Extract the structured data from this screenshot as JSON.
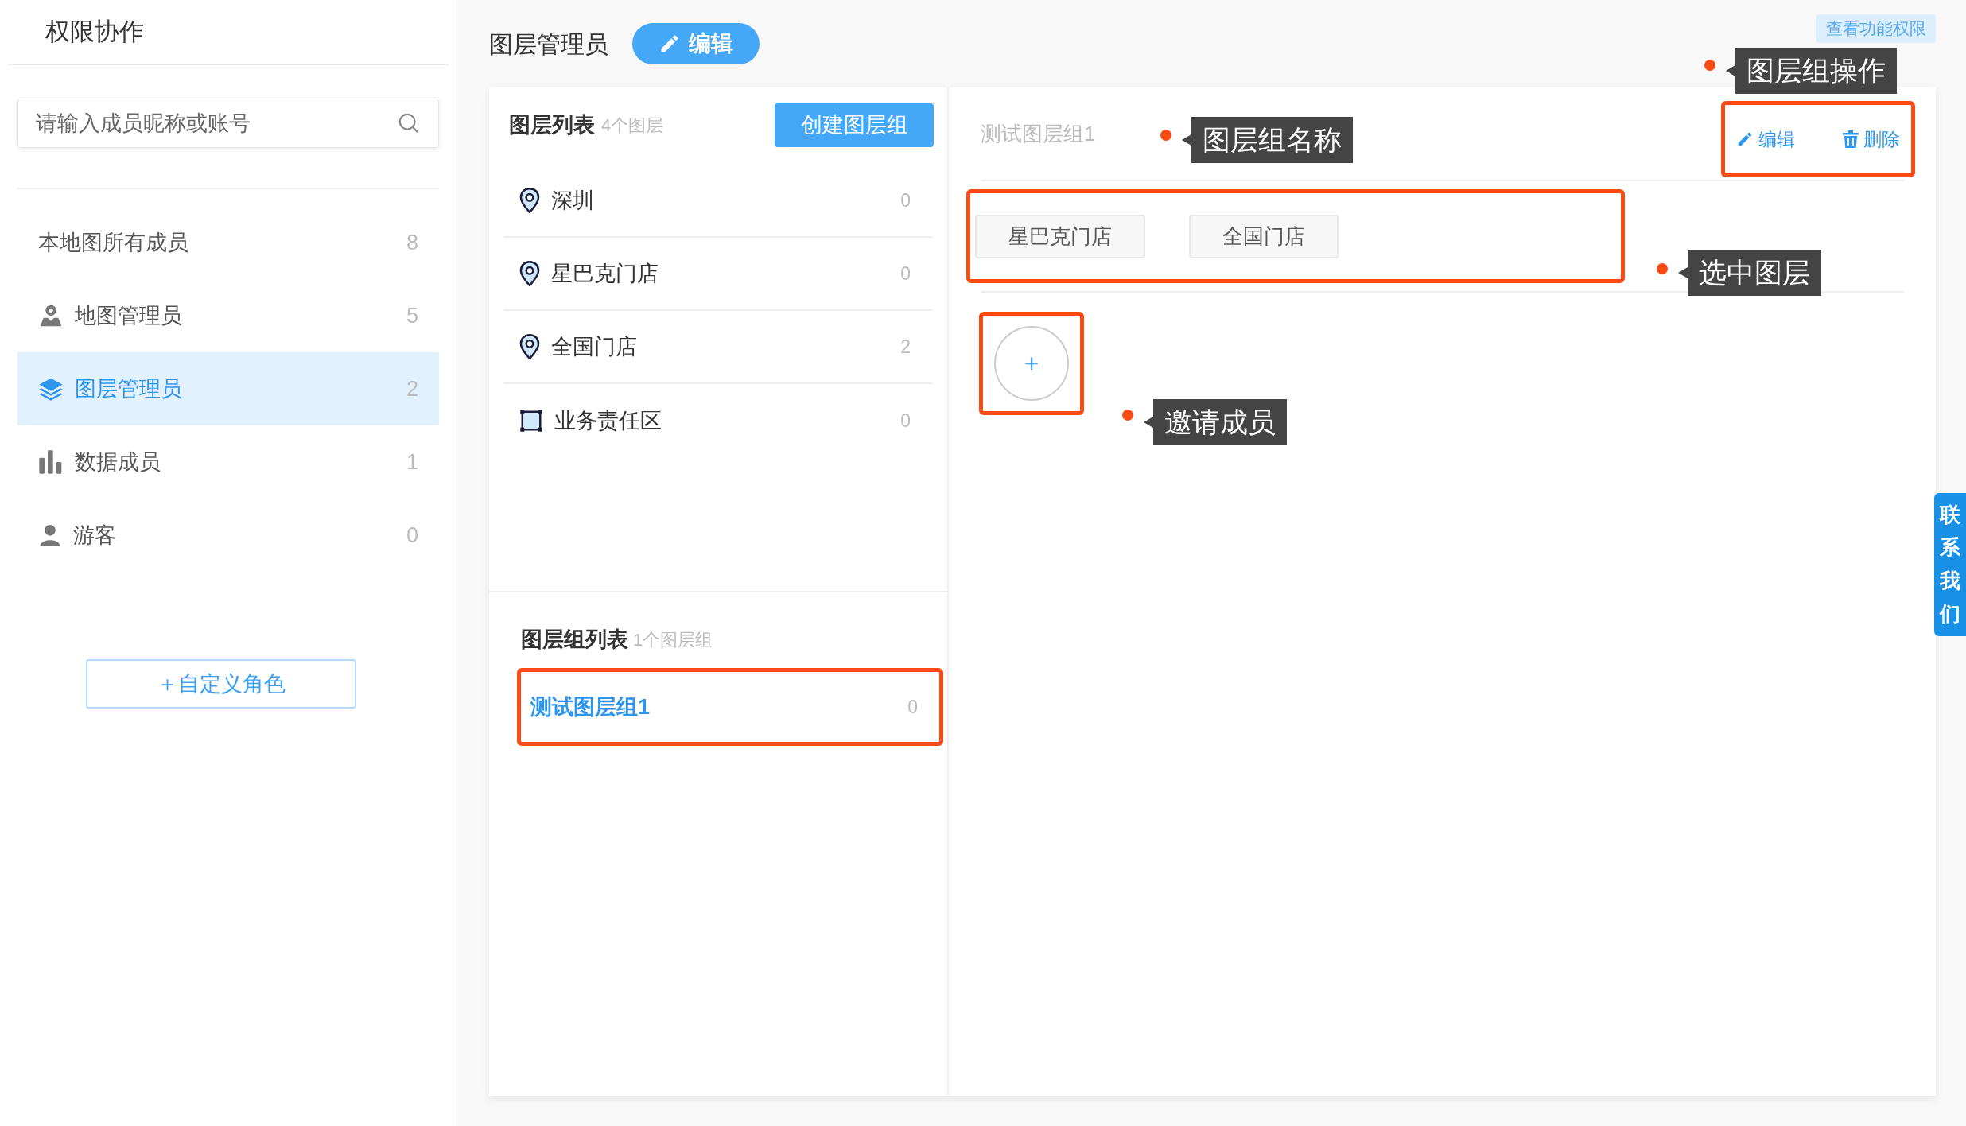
{
  "sidebar": {
    "title": "权限协作",
    "search": {
      "placeholder": "请输入成员昵称或账号"
    },
    "items": [
      {
        "label": "本地图所有成员",
        "count": "8",
        "selected": false
      },
      {
        "label": "地图管理员",
        "count": "5",
        "selected": false
      },
      {
        "label": "图层管理员",
        "count": "2",
        "selected": true
      },
      {
        "label": "数据成员",
        "count": "1",
        "selected": false
      },
      {
        "label": "游客",
        "count": "0",
        "selected": false
      }
    ],
    "add_button": "＋自定义角色"
  },
  "header": {
    "title": "图层管理员",
    "edit_button": "编辑",
    "permissions_button": "查看功能权限"
  },
  "layer_list": {
    "title": "图层列表",
    "subtitle": "4个图层",
    "create_button": "创建图层组",
    "items": [
      {
        "kind": "point",
        "label": "深圳",
        "count": "0"
      },
      {
        "kind": "point",
        "label": "星巴克门店",
        "count": "0"
      },
      {
        "kind": "point",
        "label": "全国门店",
        "count": "2"
      },
      {
        "kind": "polygon",
        "label": "业务责任区",
        "count": "0"
      }
    ]
  },
  "group_list": {
    "title": "图层组列表",
    "subtitle": "1个图层组",
    "items": [
      {
        "label": "测试图层组1",
        "count": "0",
        "selected": true
      }
    ]
  },
  "group_detail": {
    "name": "测试图层组1",
    "edit": "编辑",
    "delete": "删除",
    "layers": [
      "星巴克门店",
      "全国门店"
    ],
    "invite_button": "+"
  },
  "callouts": [
    "图层组操作",
    "图层组名称",
    "选中图层",
    "邀请成员"
  ],
  "contact_tab": "联系我们"
}
